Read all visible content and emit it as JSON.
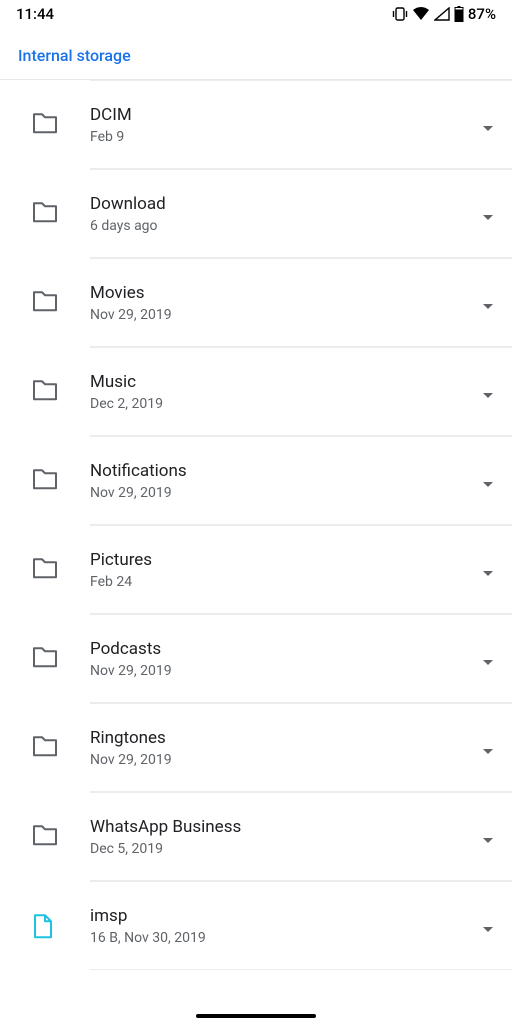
{
  "status_bar": {
    "time": "11:44",
    "battery_pct": "87%",
    "icons": {
      "vibrate": "vibrate-icon",
      "wifi": "wifi-icon",
      "signal": "cell-signal-icon",
      "battery": "battery-icon"
    }
  },
  "breadcrumb": "Internal storage",
  "folders": [
    {
      "name": "DCIM",
      "sub": "Feb 9",
      "type": "folder"
    },
    {
      "name": "Download",
      "sub": "6 days ago",
      "type": "folder"
    },
    {
      "name": "Movies",
      "sub": "Nov 29, 2019",
      "type": "folder"
    },
    {
      "name": "Music",
      "sub": "Dec 2, 2019",
      "type": "folder"
    },
    {
      "name": "Notifications",
      "sub": "Nov 29, 2019",
      "type": "folder"
    },
    {
      "name": "Pictures",
      "sub": "Feb 24",
      "type": "folder"
    },
    {
      "name": "Podcasts",
      "sub": "Nov 29, 2019",
      "type": "folder"
    },
    {
      "name": "Ringtones",
      "sub": "Nov 29, 2019",
      "type": "folder"
    },
    {
      "name": "WhatsApp Business",
      "sub": "Dec 5, 2019",
      "type": "folder"
    },
    {
      "name": "imsp",
      "sub": "16 B, Nov 30, 2019",
      "type": "file"
    }
  ],
  "colors": {
    "accent": "#1a73e8",
    "text_primary": "#202124",
    "text_secondary": "#5f6368",
    "folder_icon": "#5f6368",
    "file_icon": "#1ec3e0",
    "divider": "#ececec"
  }
}
